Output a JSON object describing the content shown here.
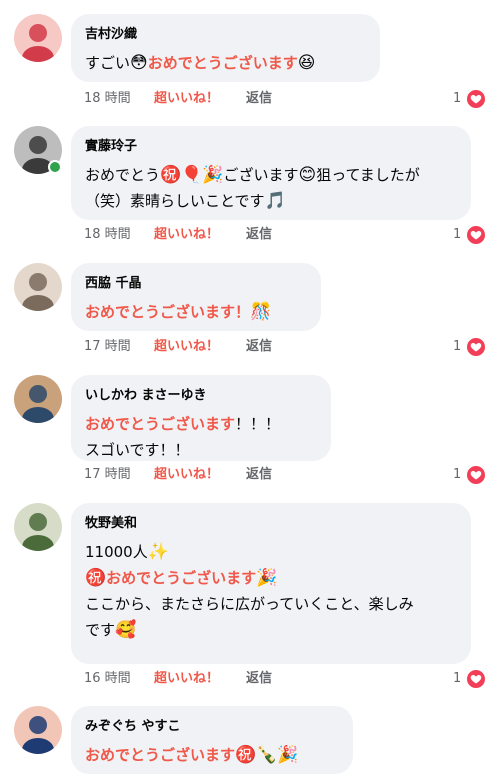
{
  "comments": [
    {
      "author": "吉村沙織",
      "lines": [
        [
          {
            "t": "すごい"
          },
          {
            "t": "😳",
            "e": 1
          },
          {
            "t": "おめでとうございます",
            "o": 1
          },
          {
            "t": "😆",
            "e": 1
          }
        ]
      ],
      "time": "18 時間",
      "super_like": "超いいね！",
      "reply": "返信",
      "reaction_count": "1",
      "reaction_icon": "heart-icon"
    },
    {
      "author": "實藤玲子",
      "lines": [
        [
          {
            "t": "おめでとう"
          },
          {
            "t": "㊗️",
            "e": 1
          },
          {
            "t": "🎈",
            "e": 1
          },
          {
            "t": "🎉",
            "e": 1
          },
          {
            "t": "ございます"
          },
          {
            "t": "😊",
            "e": 1
          },
          {
            "t": "狙ってましたが"
          }
        ],
        [
          {
            "t": "（笑）素晴らしいことです"
          },
          {
            "t": "🎵",
            "e": 1
          }
        ]
      ],
      "time": "18 時間",
      "super_like": "超いいね！",
      "reply": "返信",
      "reaction_count": "1",
      "reaction_icon": "heart-icon",
      "online": true
    },
    {
      "author": "西脇 千晶",
      "lines": [
        [
          {
            "t": "おめでとうございます！",
            "o": 1
          },
          {
            "t": "🎊",
            "e": 1
          }
        ]
      ],
      "time": "17 時間",
      "super_like": "超いいね！",
      "reply": "返信",
      "reaction_count": "1",
      "reaction_icon": "heart-icon"
    },
    {
      "author": "いしかわ まさーゆき",
      "lines": [
        [
          {
            "t": "おめでとうございます",
            "o": 1
          },
          {
            "t": "！！！"
          }
        ],
        [
          {
            "t": "スゴいです！！"
          }
        ]
      ],
      "time": "17 時間",
      "super_like": "超いいね！",
      "reply": "返信",
      "reaction_count": "1",
      "reaction_icon": "heart-icon"
    },
    {
      "author": "牧野美和",
      "lines": [
        [
          {
            "t": "11000人"
          },
          {
            "t": "✨",
            "e": 1
          }
        ],
        [
          {
            "t": "㊗️",
            "e": 1
          },
          {
            "t": "おめでとうございます",
            "o": 1
          },
          {
            "t": "🎉",
            "e": 1
          }
        ],
        [
          {
            "t": "ここから、またさらに広がっていくこと、楽しみ"
          }
        ],
        [
          {
            "t": "です"
          },
          {
            "t": "🥰",
            "e": 1
          }
        ]
      ],
      "time": "16 時間",
      "super_like": "超いいね！",
      "reply": "返信",
      "reaction_count": "1",
      "reaction_icon": "heart-icon"
    },
    {
      "author": "みぞぐち やすこ",
      "lines": [
        [
          {
            "t": "おめでとうございます",
            "o": 1
          },
          {
            "t": "㊗️",
            "e": 1
          },
          {
            "t": "🍾",
            "e": 1
          },
          {
            "t": "🎉",
            "e": 1
          }
        ]
      ],
      "reaction_icon": "heart-icon"
    }
  ]
}
